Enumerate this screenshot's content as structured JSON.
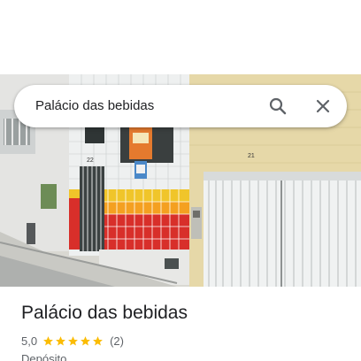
{
  "search": {
    "query": "Palácio das bebidas"
  },
  "place": {
    "name": "Palácio das bebidas",
    "rating": "5,0",
    "stars": 5,
    "review_count": "(2)",
    "category": "Depósito"
  },
  "photo": {
    "house_number_left": "22",
    "house_number_right": "21"
  },
  "colors": {
    "star": "#fbbc04",
    "title_text": "#202124",
    "secondary_text": "#5f6368",
    "icon": "#5f6368"
  },
  "icons": {
    "search": "search-icon",
    "close": "close-icon",
    "star": "star-icon"
  }
}
